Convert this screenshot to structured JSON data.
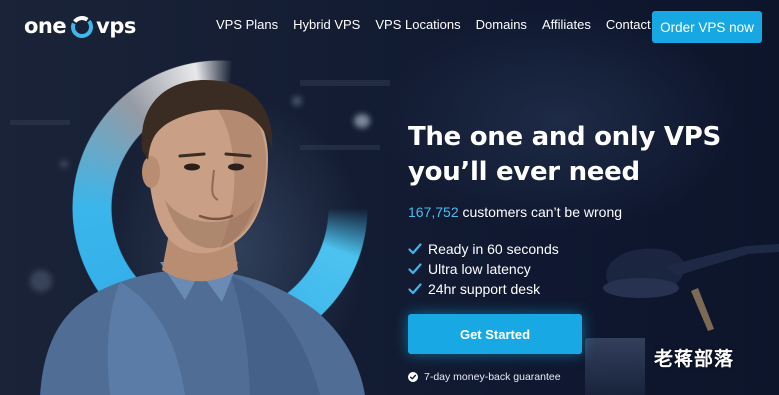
{
  "logo": {
    "part1": "one",
    "part2": "vps",
    "icon": "circle-logo-icon"
  },
  "nav": {
    "items": [
      {
        "label": "VPS Plans"
      },
      {
        "label": "Hybrid VPS"
      },
      {
        "label": "VPS Locations"
      },
      {
        "label": "Domains"
      },
      {
        "label": "Affiliates"
      },
      {
        "label": "Contact"
      }
    ],
    "order_button": "Order VPS now"
  },
  "hero": {
    "headline_line1": "The one and only VPS",
    "headline_line2": "you’ll ever need",
    "customer_count": "167,752",
    "customer_text": " customers can’t be wrong",
    "features": [
      {
        "label": "Ready in 60 seconds",
        "icon": "check-icon"
      },
      {
        "label": "Ultra low latency",
        "icon": "check-icon"
      },
      {
        "label": "24hr support desk",
        "icon": "check-icon"
      }
    ],
    "cta_label": "Get Started",
    "guarantee": "7-day money-back guarantee",
    "guarantee_icon": "check-circle-icon"
  },
  "watermark": "老蒋部落",
  "colors": {
    "accent": "#17a8e3",
    "highlight": "#4dbbef",
    "background": "#101a33"
  }
}
